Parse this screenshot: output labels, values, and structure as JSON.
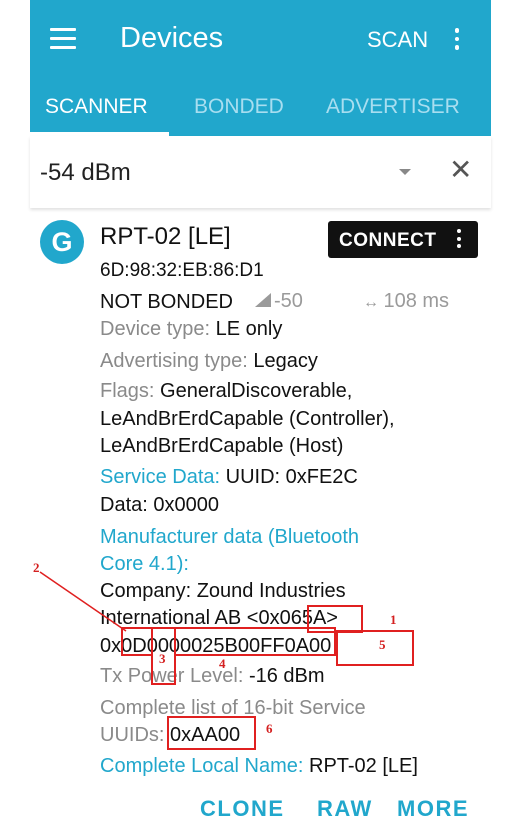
{
  "header": {
    "title": "Devices",
    "scan_label": "SCAN"
  },
  "tabs": [
    {
      "label": "SCANNER",
      "active": true
    },
    {
      "label": "BONDED",
      "active": false
    },
    {
      "label": "ADVERTISER",
      "active": false
    }
  ],
  "filter": {
    "value": "-54 dBm"
  },
  "device": {
    "avatar_letter": "G",
    "name": "RPT-02 [LE]",
    "address": "6D:98:32:EB:86:D1",
    "connect_label": "CONNECT",
    "bond_state": "NOT BONDED",
    "rssi": "-50",
    "interval": "108 ms",
    "device_type_label": "Device type:",
    "device_type": "LE only",
    "adv_type_label": "Advertising type:",
    "adv_type": "Legacy",
    "flags_label": "Flags:",
    "flags_line1": "GeneralDiscoverable,",
    "flags_line2": "LeAndBrErdCapable (Controller),",
    "flags_line3": "LeAndBrErdCapable (Host)",
    "service_data_label": "Service Data:",
    "service_data_uuid": "UUID: 0xFE2C",
    "service_data_value": "Data: 0x0000",
    "mfr_label_line1": "Manufacturer data (Bluetooth",
    "mfr_label_line2": "Core 4.1):",
    "company_line1": "Company: Zound Industries",
    "company_line2": "International AB <0x065A>",
    "mfr_data": "0x0D0000025B00FF0A00",
    "tx_label": "Tx Power Level:",
    "tx_value": "-16 dBm",
    "uuid_list_label_line1": "Complete list of 16-bit Service",
    "uuid_list_label_line2": "UUIDs:",
    "uuid_list_value": "0xAA00",
    "local_name_label": "Complete Local Name:",
    "local_name": "RPT-02 [LE]"
  },
  "actions": {
    "clone": "CLONE",
    "raw": "RAW",
    "more": "MORE"
  },
  "annotations": [
    "1",
    "2",
    "3",
    "4",
    "5",
    "6"
  ],
  "colors": {
    "accent": "#21a7cc",
    "annotation": "#e02020"
  }
}
